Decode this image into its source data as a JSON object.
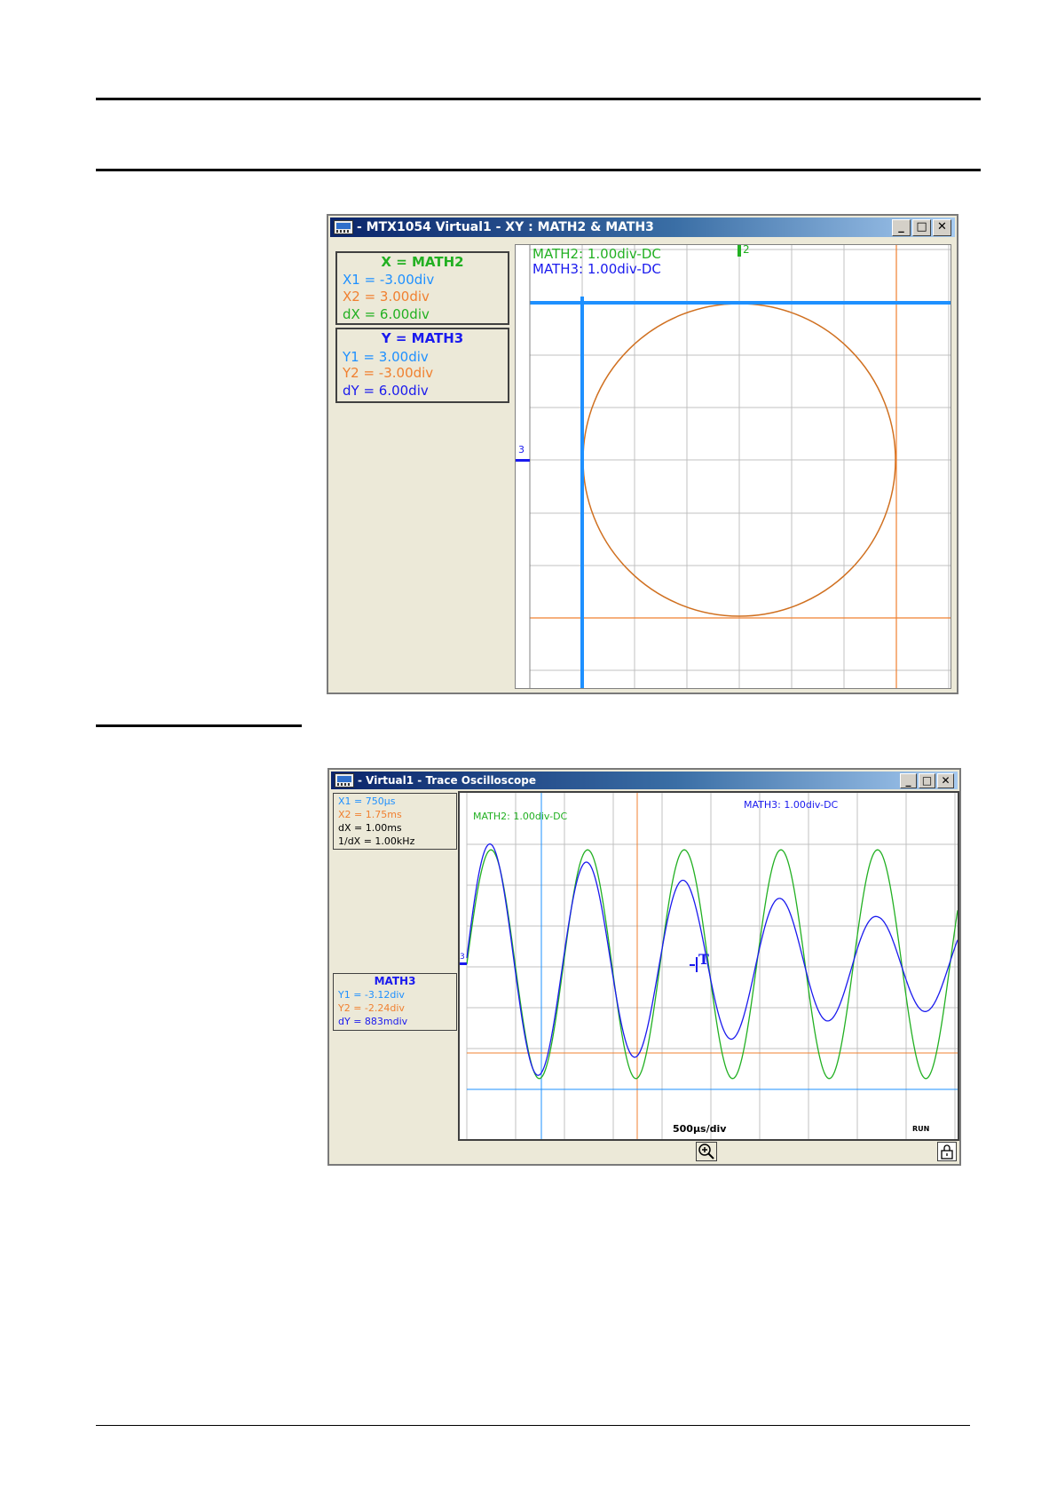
{
  "window1": {
    "title": "- MTX1054 Virtual1 - XY : MATH2 & MATH3",
    "buttons": {
      "minimize": "_",
      "maximize": "□",
      "close": "✕"
    },
    "x_panel": {
      "heading": "X = MATH2",
      "x1": "X1 = -3.00div",
      "x2": "X2 = 3.00div",
      "dx": "dX = 6.00div"
    },
    "y_panel": {
      "heading": "Y = MATH3",
      "y1": "Y1 = 3.00div",
      "y2": "Y2 = -3.00div",
      "dy": "dY = 6.00div"
    },
    "legend": {
      "math2": "MATH2: 1.00div-DC",
      "math3": "MATH3: 1.00div-DC"
    },
    "markers": {
      "top": "2",
      "left": "3"
    },
    "colors": {
      "math2": "#22b022",
      "math3": "#1a1aee",
      "cursor1": "#1e90ff",
      "cursor2": "#f08030",
      "curve": "#d07020",
      "grid": "#c0c0c0"
    }
  },
  "window2": {
    "title": "- Virtual1 - Trace Oscilloscope",
    "buttons": {
      "minimize": "_",
      "maximize": "□",
      "close": "✕"
    },
    "x_panel": {
      "x1": "X1 = 750µs",
      "x2": "X2 = 1.75ms",
      "dx": "dX = 1.00ms",
      "inv_dx": "1/dX = 1.00kHz"
    },
    "y_panel": {
      "heading": "MATH3",
      "y1": "Y1 = -3.12div",
      "y2": "Y2 = -2.24div",
      "dy": "dY = 883mdiv"
    },
    "legend": {
      "math2": "MATH2: 1.00div-DC",
      "math3": "MATH3: 1.00div-DC"
    },
    "timebase": "500µs/div",
    "status": "RUN",
    "trigger_marker": "T",
    "left_marker": "3",
    "icons": {
      "zoom": "zoom-icon",
      "lock": "lock-icon"
    },
    "colors": {
      "math2": "#22b022",
      "math3": "#1a1aee",
      "cursor1": "#1e90ff",
      "cursor2": "#f08030",
      "grid": "#c0c0c0"
    }
  }
}
